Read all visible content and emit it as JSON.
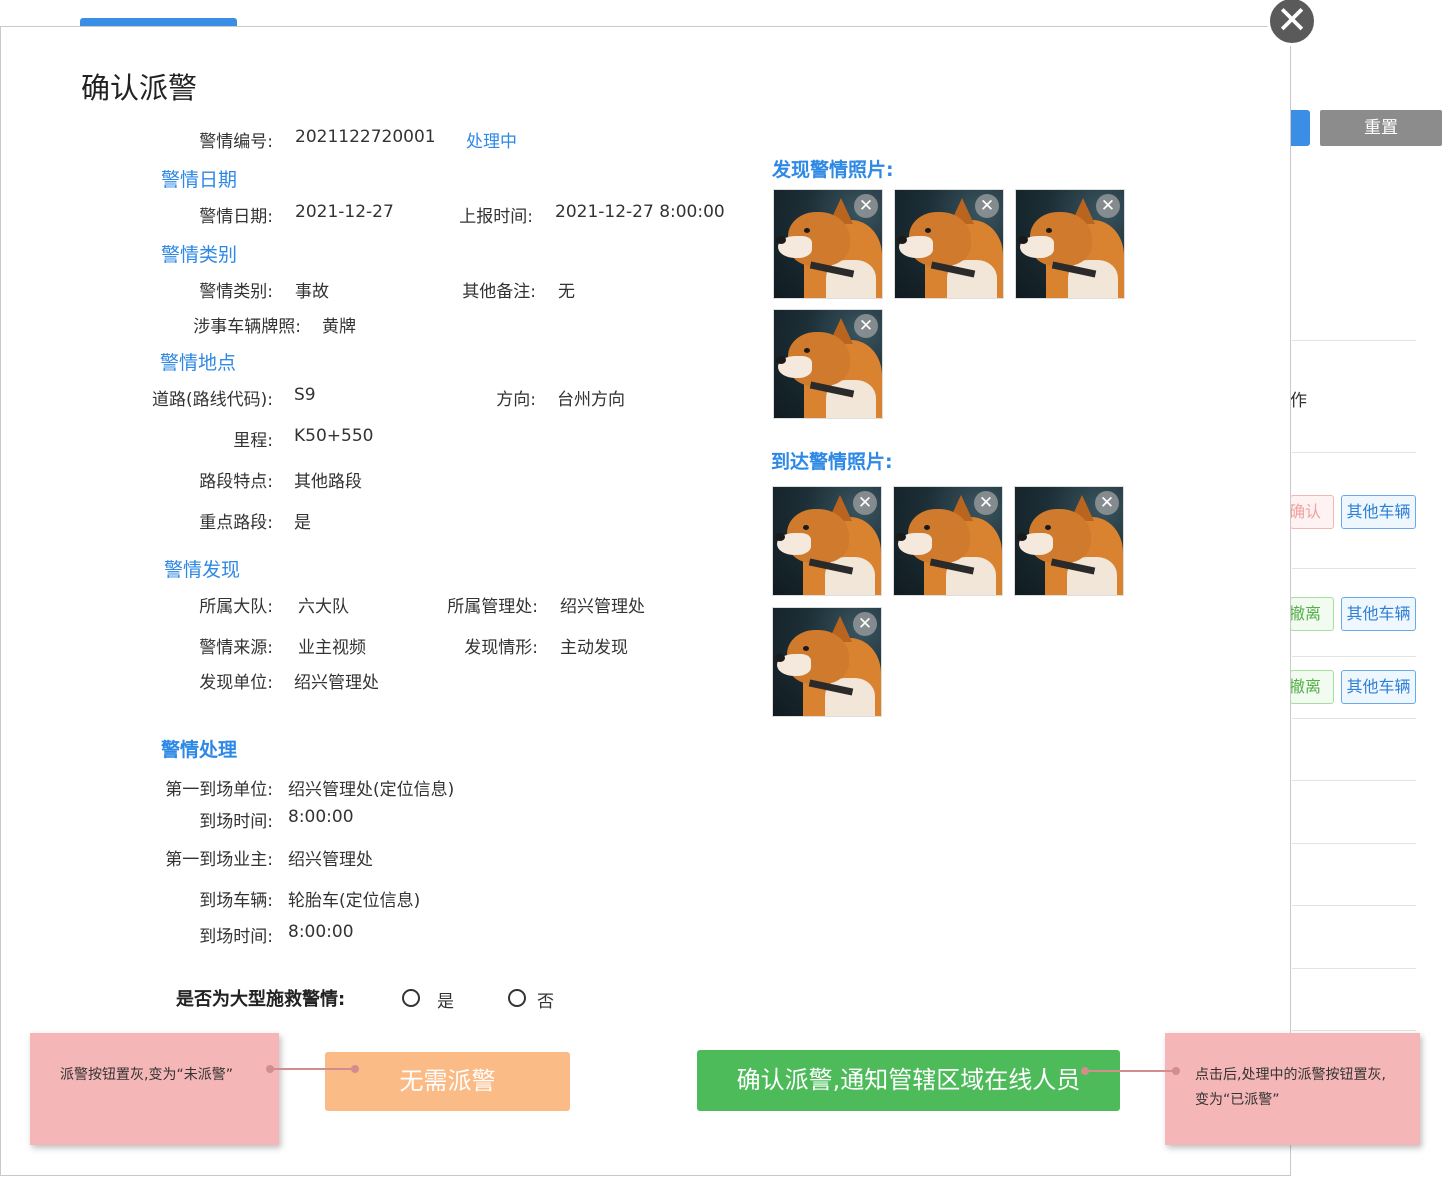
{
  "background": {
    "reset_label": "重置",
    "col_head_fragment": "作",
    "rows": [
      {
        "left_chip": "确认",
        "right_chip": "其他车辆"
      },
      {
        "left_chip": "撤离",
        "right_chip": "其他车辆"
      },
      {
        "left_chip": "撤离",
        "right_chip": "其他车辆"
      }
    ]
  },
  "modal": {
    "title": "确认派警",
    "close_icon": "close-icon",
    "alert_no_label": "警情编号:",
    "alert_no_value": "2021122720001",
    "status": "处理中",
    "sections": {
      "date": "警情日期",
      "category": "警情类别",
      "location": "警情地点",
      "discovery": "警情发现",
      "handling": "警情处理"
    },
    "date": {
      "date_label": "警情日期:",
      "date_value": "2021-12-27",
      "report_label": "上报时间:",
      "report_value": "2021-12-27 8:00:00"
    },
    "category": {
      "type_label": "警情类别:",
      "type_value": "事故",
      "remark_label": "其他备注:",
      "remark_value": "无",
      "plate_label": "涉事车辆牌照:",
      "plate_value": "黄牌"
    },
    "location": {
      "road_label": "道路(路线代码):",
      "road_value": "S9",
      "direction_label": "方向:",
      "direction_value": "台州方向",
      "mileage_label": "里程:",
      "mileage_value": "K50+550",
      "feature_label": "路段特点:",
      "feature_value": "其他路段",
      "key_label": "重点路段:",
      "key_value": "是"
    },
    "discovery": {
      "brigade_label": "所属大队:",
      "brigade_value": "六大队",
      "office_label": "所属管理处:",
      "office_value": "绍兴管理处",
      "source_label": "警情来源:",
      "source_value": "业主视频",
      "situation_label": "发现情形:",
      "situation_value": "主动发现",
      "unit_label": "发现单位:",
      "unit_value": "绍兴管理处"
    },
    "handling": {
      "first_unit_label": "第一到场单位:",
      "first_unit_value": "绍兴管理处(定位信息)",
      "arrive_time1_label": "到场时间:",
      "arrive_time1_value": "8:00:00",
      "first_owner_label": "第一到场业主:",
      "first_owner_value": "绍兴管理处",
      "vehicle_label": "到场车辆:",
      "vehicle_value": "轮胎车(定位信息)",
      "arrive_time2_label": "到场时间:",
      "arrive_time2_value": "8:00:00"
    },
    "photos": {
      "found_title": "发现警情照片:",
      "arrive_title": "到达警情照片:",
      "found_count": 4,
      "arrive_count": 4
    },
    "large_rescue": {
      "question": "是否为大型施救警情:",
      "yes": "是",
      "no": "否"
    },
    "buttons": {
      "no_dispatch": "无需派警",
      "confirm_dispatch": "确认派警,通知管辖区域在线人员"
    }
  },
  "notes": {
    "left": "派警按钮置灰,变为“未派警”",
    "right": "点击后,处理中的派警按钮置灰,变为“已派警”"
  }
}
